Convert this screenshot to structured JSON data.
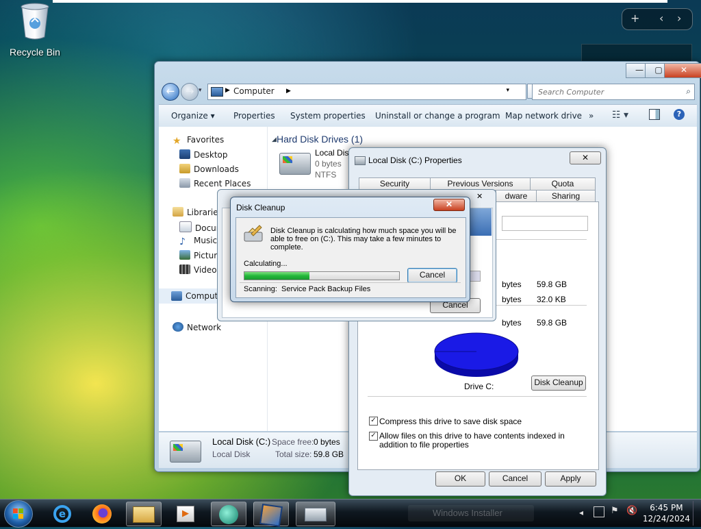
{
  "desktop": {
    "recycle_bin_label": "Recycle Bin",
    "gadget_add": "+",
    "gadget_prev": "‹",
    "gadget_next": "›"
  },
  "explorer": {
    "breadcrumb": "Computer",
    "search_placeholder": "Search Computer",
    "toolbar": {
      "organize": "Organize ▾",
      "properties": "Properties",
      "system_properties": "System properties",
      "uninstall": "Uninstall or change a program",
      "map_drive": "Map network drive",
      "more": "»"
    },
    "nav": {
      "favorites": "Favorites",
      "desktop": "Desktop",
      "downloads": "Downloads",
      "recent": "Recent Places",
      "libraries": "Libraries",
      "documents": "Docum",
      "music": "Music",
      "pictures": "Picture",
      "videos": "Videos",
      "computer": "Comput",
      "network": "Network"
    },
    "group_header": "Hard Disk Drives (1)",
    "drive": {
      "name": "Local Dis",
      "bytes": "0 bytes",
      "fs": "NTFS"
    },
    "status": {
      "name": "Local Disk (C:)",
      "type": "Local Disk",
      "space_free_label": "Space free:",
      "space_free_value": "0 bytes",
      "total_size_label": "Total size:",
      "total_size_value": "59.8 GB"
    }
  },
  "properties_dialog": {
    "title": "Local Disk (C:) Properties",
    "tabs_row1": [
      "Security",
      "Previous Versions",
      "Quota"
    ],
    "tabs_row2": [
      "dware",
      "Sharing"
    ],
    "rows": [
      {
        "unit": "bytes",
        "size": "59.8 GB"
      },
      {
        "unit": "bytes",
        "size": "32.0 KB"
      },
      {
        "unit": "bytes",
        "size": "59.8 GB"
      }
    ],
    "drive_label": "Drive C:",
    "disk_cleanup_button": "Disk Cleanup",
    "compress_label": "Compress this drive to save disk space",
    "index_label": "Allow files on this drive to have contents indexed in addition to file properties",
    "ok": "OK",
    "cancel": "Cancel",
    "apply": "Apply"
  },
  "disk_cleanup_back": {
    "cancel": "Cancel"
  },
  "disk_cleanup": {
    "title": "Disk Cleanup",
    "message": "Disk Cleanup is calculating how much space you will be able to free on  (C:). This may take a few minutes to complete.",
    "calculating": "Calculating...",
    "progress": 0.42,
    "cancel": "Cancel",
    "scanning_label": "Scanning:",
    "scanning_item": "Service Pack Backup Files"
  },
  "taskbar": {
    "time": "6:45 PM",
    "date": "12/24/2024",
    "ghost_label": "Windows Installer"
  },
  "colors": {
    "progress_green": "#22b83a",
    "pie_blue": "#1010e0",
    "close_red": "#c84020"
  }
}
